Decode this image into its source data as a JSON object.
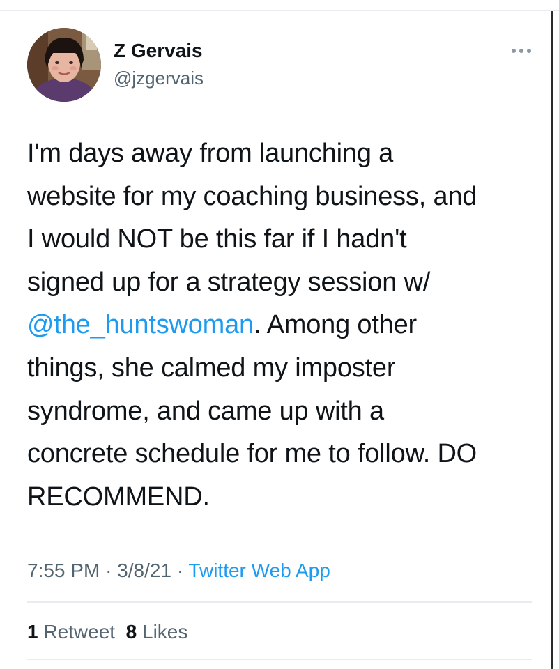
{
  "tweet": {
    "author": {
      "name": "Z Gervais",
      "handle": "@jzgervais"
    },
    "text_lines": [
      {
        "before": "I'm days away from launching a",
        "mention": "",
        "after": ""
      },
      {
        "before": "website for my coaching business, and",
        "mention": "",
        "after": ""
      },
      {
        "before": "I would NOT be this far if I hadn't",
        "mention": "",
        "after": ""
      },
      {
        "before": "signed up for a strategy session w/",
        "mention": "",
        "after": ""
      },
      {
        "before": "",
        "mention": "@the_huntswoman",
        "after": ". Among other"
      },
      {
        "before": "things, she calmed my imposter",
        "mention": "",
        "after": ""
      },
      {
        "before": "syndrome, and came up with a",
        "mention": "",
        "after": ""
      },
      {
        "before": "concrete schedule for me to follow. DO",
        "mention": "",
        "after": ""
      },
      {
        "before": "RECOMMEND.",
        "mention": "",
        "after": ""
      }
    ],
    "time": "7:55 PM",
    "date": "3/8/21",
    "separator": "·",
    "source": "Twitter Web App",
    "stats": {
      "retweets_count": "1",
      "retweets_label": "Retweet",
      "likes_count": "8",
      "likes_label": "Likes"
    }
  },
  "icons": {
    "more": "more-horizontal-icon",
    "avatar": "profile-photo"
  },
  "colors": {
    "text": "#0f1419",
    "secondary": "#536471",
    "link": "#1d9bf0",
    "divider": "#e6ecf0"
  }
}
